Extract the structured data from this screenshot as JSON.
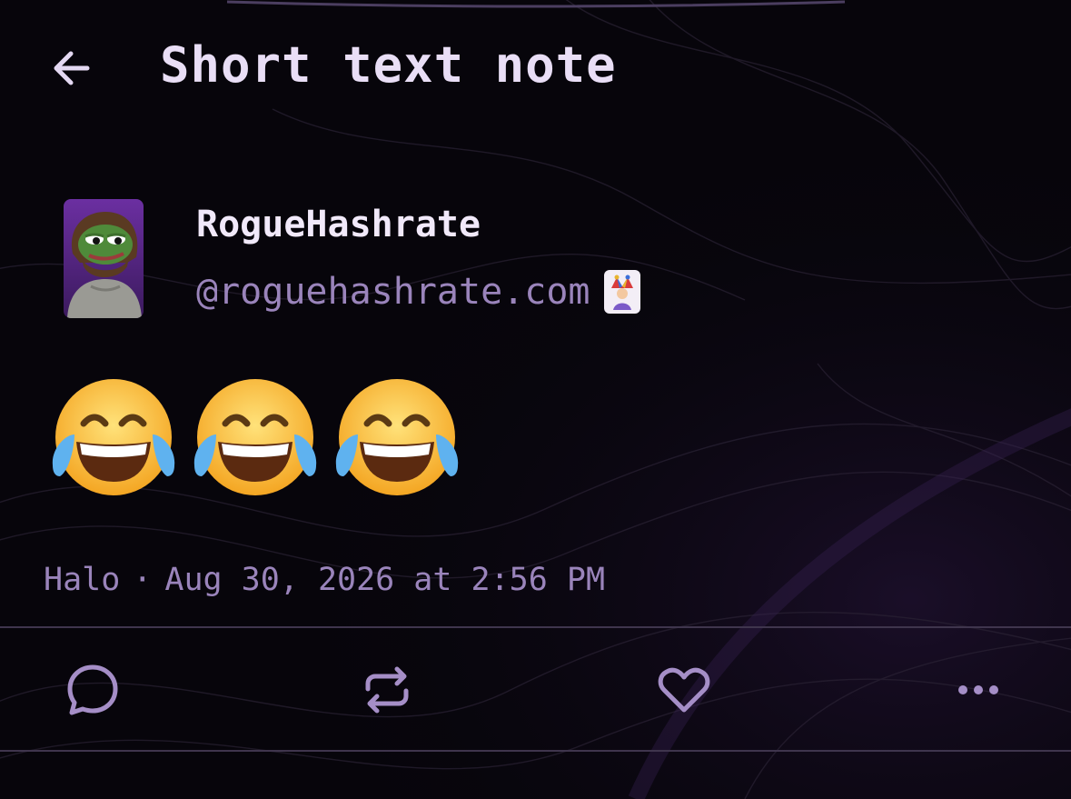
{
  "header": {
    "back_icon": "arrow-left-icon",
    "title": "Short text note"
  },
  "author": {
    "display_name": "RogueHashrate",
    "handle": "@roguehashrate.com",
    "avatar_icon": "pepe-frog-avatar",
    "badge_icon": "joker-card-icon"
  },
  "note": {
    "content_emojis": [
      "face-with-tears-of-joy",
      "face-with-tears-of-joy",
      "face-with-tears-of-joy"
    ],
    "client": "Halo",
    "separator": "·",
    "timestamp": "Aug 30, 2026 at 2:56 PM"
  },
  "actions": {
    "reply_icon": "speech-bubble-icon",
    "repost_icon": "repost-icon",
    "like_icon": "heart-icon",
    "more_icon": "more-dots-icon"
  },
  "colors": {
    "background": "#07050b",
    "accent": "#9a84bb",
    "title": "#e9def6",
    "divider": "#3f354d"
  }
}
